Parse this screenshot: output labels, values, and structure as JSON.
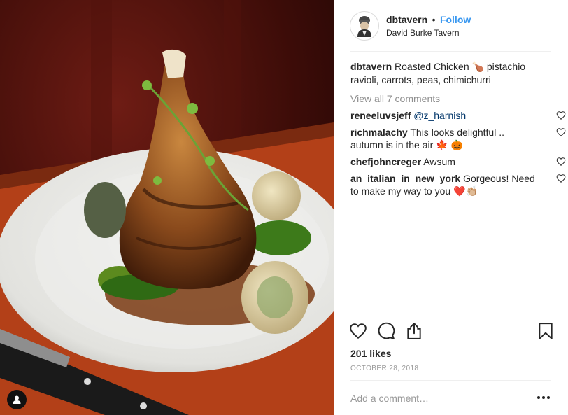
{
  "post": {
    "username": "dbtavern",
    "separator": "•",
    "follow_label": "Follow",
    "location": "David Burke Tavern",
    "caption_user": "dbtavern",
    "caption_text": "Roasted Chicken 🍗 pistachio ravioli, carrots, peas, chimichurri",
    "view_all_label": "View all 7 comments",
    "likes": "201 likes",
    "date": "OCTOBER 28, 2018",
    "add_comment_placeholder": "Add a comment…"
  },
  "comments": [
    {
      "user": "reneeluvsjeff",
      "text": "",
      "mention": "@z_harnish"
    },
    {
      "user": "richmalachy",
      "text": "This looks delightful .. autumn is in the air 🍁 🎃",
      "mention": ""
    },
    {
      "user": "chefjohncreger",
      "text": "Awsum",
      "mention": ""
    },
    {
      "user": "an_italian_in_new_york",
      "text": "Gorgeous! Need to make my way to you ❤️👏🏼",
      "mention": ""
    }
  ],
  "icons": {
    "like": "heart-icon",
    "comment": "comment-bubble-icon",
    "share": "share-icon",
    "save": "bookmark-icon",
    "more": "more-options-icon",
    "tag": "user-tag-icon"
  },
  "colors": {
    "accent": "#3897f0",
    "muted": "#8e8e8e",
    "text": "#262626"
  }
}
